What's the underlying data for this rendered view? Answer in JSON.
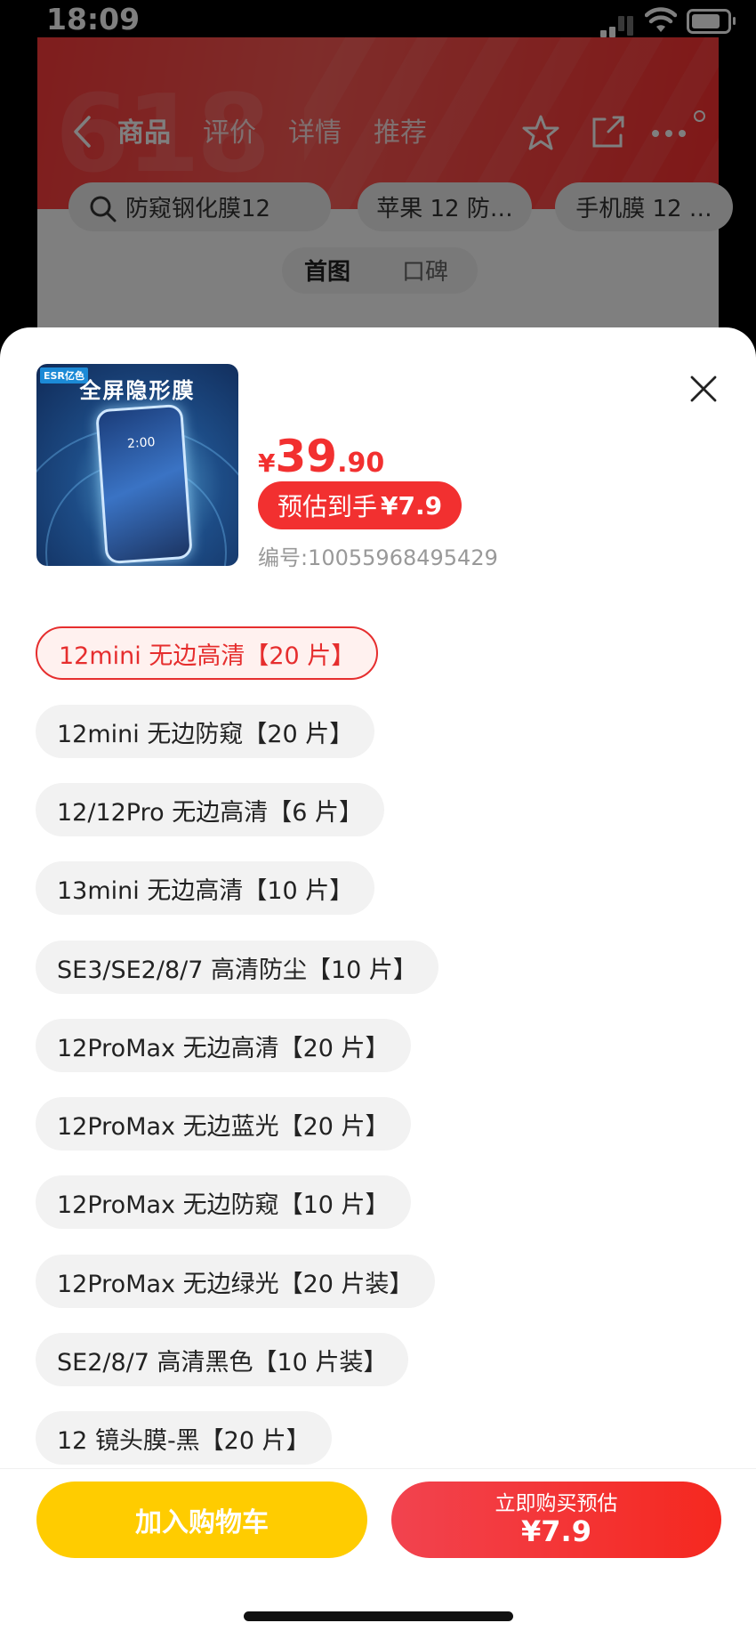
{
  "status_bar": {
    "time": "18:09"
  },
  "background_page": {
    "hero_text": "618",
    "nav_tabs": [
      {
        "label": "商品",
        "active": true
      },
      {
        "label": "评价",
        "active": false
      },
      {
        "label": "详情",
        "active": false
      },
      {
        "label": "推荐",
        "active": false
      }
    ],
    "search": {
      "value": "防窥钢化膜12"
    },
    "suggestions": [
      "苹果 12 防…",
      "手机膜 12 …"
    ],
    "sub_tabs": [
      "首图",
      "口碑"
    ]
  },
  "product": {
    "thumbnail_brand": "ESR亿色",
    "thumbnail_title": "全屏隐形膜",
    "thumbnail_clock": "2:00",
    "price": {
      "currency": "¥",
      "integer": "39",
      "decimal": ".90"
    },
    "estimate": {
      "label": "预估到手",
      "value": "¥7.9"
    },
    "code": "编号:10055968495429"
  },
  "options": [
    {
      "label": "12mini 无边高清【20 片】",
      "selected": true
    },
    {
      "label": "12mini 无边防窥【20 片】",
      "selected": false
    },
    {
      "label": "12/12Pro 无边高清【6 片】",
      "selected": false
    },
    {
      "label": "13mini 无边高清【10 片】",
      "selected": false
    },
    {
      "label": "SE3/SE2/8/7 高清防尘【10 片】",
      "selected": false
    },
    {
      "label": "12ProMax 无边高清【20 片】",
      "selected": false
    },
    {
      "label": "12ProMax 无边蓝光【20 片】",
      "selected": false
    },
    {
      "label": "12ProMax 无边防窥【10 片】",
      "selected": false
    },
    {
      "label": "12ProMax 无边绿光【20 片装】",
      "selected": false
    },
    {
      "label": "SE2/8/7 高清黑色【10 片装】",
      "selected": false
    },
    {
      "label": "12 镜头膜-黑【20 片】",
      "selected": false
    }
  ],
  "actions": {
    "add_to_cart": "加入购物车",
    "buy_now_line1": "立即购买预估",
    "buy_now_line2": "¥7.9"
  },
  "colors": {
    "price_red": "#f23030",
    "cart_yellow": "#ffcc00",
    "selected_border": "#e62e2e"
  }
}
